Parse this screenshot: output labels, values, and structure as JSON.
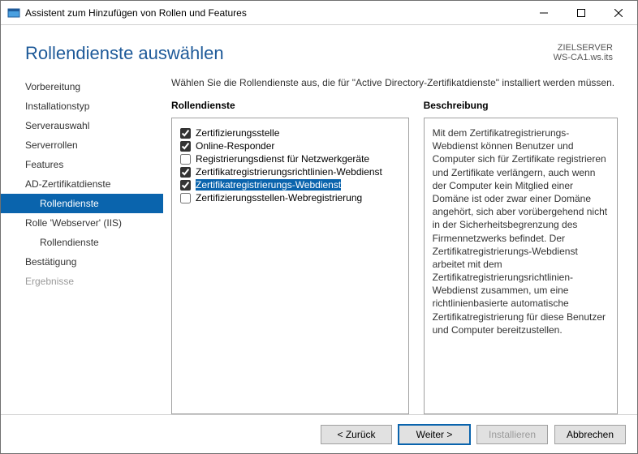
{
  "window": {
    "title": "Assistent zum Hinzufügen von Rollen und Features"
  },
  "header": {
    "title": "Rollendienste auswählen",
    "target_label": "ZIELSERVER",
    "target_value": "WS-CA1.ws.its"
  },
  "sidebar": {
    "items": [
      {
        "label": "Vorbereitung",
        "indent": false,
        "selected": false,
        "disabled": false
      },
      {
        "label": "Installationstyp",
        "indent": false,
        "selected": false,
        "disabled": false
      },
      {
        "label": "Serverauswahl",
        "indent": false,
        "selected": false,
        "disabled": false
      },
      {
        "label": "Serverrollen",
        "indent": false,
        "selected": false,
        "disabled": false
      },
      {
        "label": "Features",
        "indent": false,
        "selected": false,
        "disabled": false
      },
      {
        "label": "AD-Zertifikatdienste",
        "indent": false,
        "selected": false,
        "disabled": false
      },
      {
        "label": "Rollendienste",
        "indent": true,
        "selected": true,
        "disabled": false
      },
      {
        "label": "Rolle 'Webserver' (IIS)",
        "indent": false,
        "selected": false,
        "disabled": false
      },
      {
        "label": "Rollendienste",
        "indent": true,
        "selected": false,
        "disabled": false
      },
      {
        "label": "Bestätigung",
        "indent": false,
        "selected": false,
        "disabled": false
      },
      {
        "label": "Ergebnisse",
        "indent": false,
        "selected": false,
        "disabled": true
      }
    ]
  },
  "main": {
    "intro": "Wählen Sie die Rollendienste aus, die für \"Active Directory-Zertifikatdienste\" installiert werden müssen.",
    "roles_title": "Rollendienste",
    "desc_title": "Beschreibung",
    "roles": [
      {
        "label": "Zertifizierungsstelle",
        "checked": true,
        "selected": false
      },
      {
        "label": "Online-Responder",
        "checked": true,
        "selected": false
      },
      {
        "label": "Registrierungsdienst für Netzwerkgeräte",
        "checked": false,
        "selected": false
      },
      {
        "label": "Zertifikatregistrierungsrichtlinien-Webdienst",
        "checked": true,
        "selected": false
      },
      {
        "label": "Zertifikatregistrierungs-Webdienst",
        "checked": true,
        "selected": true
      },
      {
        "label": "Zertifizierungsstellen-Webregistrierung",
        "checked": false,
        "selected": false
      }
    ],
    "description": "Mit dem Zertifikatregistrierungs-Webdienst können Benutzer und Computer sich für Zertifikate registrieren und Zertifikate verlängern, auch wenn der Computer kein Mitglied einer Domäne ist oder zwar einer Domäne angehört, sich aber vorübergehend nicht in der Sicherheitsbegrenzung des Firmennetzwerks befindet. Der Zertifikatregistrierungs-Webdienst arbeitet mit dem Zertifikatregistrierungsrichtlinien-Webdienst zusammen, um eine richtlinienbasierte automatische Zertifikatregistrierung für diese Benutzer und Computer bereitzustellen."
  },
  "footer": {
    "back": "< Zurück",
    "next": "Weiter >",
    "install": "Installieren",
    "cancel": "Abbrechen"
  }
}
